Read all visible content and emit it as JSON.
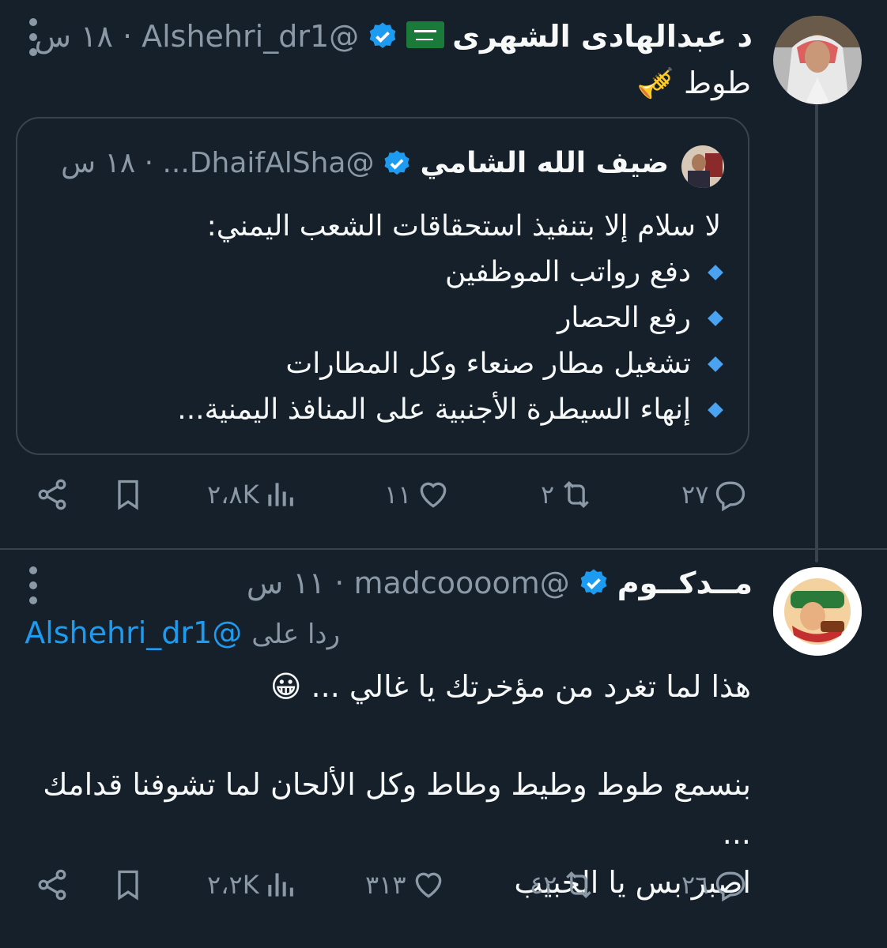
{
  "tweet1": {
    "display_name": "د عبدالهادى الشهرى",
    "handle_time": "@Alshehri_dr1 · ١٨ س",
    "body": "طوط 🎺",
    "quote": {
      "display_name": "ضيف الله الشامي",
      "handle_time": "@DhaifAlSha... · ١٨ س",
      "intro": "لا سلام إلا بتنفيذ استحقاقات الشعب اليمني:",
      "bullets": [
        "دفع رواتب الموظفين",
        "رفع الحصار",
        "تشغيل مطار صنعاء وكل المطارات",
        "إنهاء السيطرة الأجنبية على المنافذ اليمنية..."
      ]
    },
    "actions": {
      "replies": "٢٧",
      "retweets": "٢",
      "likes": "١١",
      "views": "٢،٨K"
    }
  },
  "tweet2": {
    "display_name": "مــدكــوم",
    "handle_time": "@madcoooom · ١١ س",
    "reply_prefix": "ردا على",
    "reply_handle": "@Alshehri_dr1",
    "body_line1": "هذا لما تغرد من مؤخرتك يا غالي ... 😀",
    "body_line2": "بنسمع طوط وطيط وطاط وكل الألحان لما تشوفنا قدامك ...",
    "body_line3": "اصبر بس يا الحبيب",
    "actions": {
      "replies": "٢٦",
      "retweets": "٤٢",
      "likes": "٣١٣",
      "views": "٢،٢K"
    }
  },
  "colors": {
    "background": "#15202b",
    "accent": "#1d9bf0",
    "muted": "#8b98a5",
    "border": "#38444d"
  },
  "icons": [
    "more-icon",
    "verified-icon",
    "saudi-flag-icon",
    "reply-icon",
    "retweet-icon",
    "like-icon",
    "views-icon",
    "bookmark-icon",
    "share-icon"
  ]
}
